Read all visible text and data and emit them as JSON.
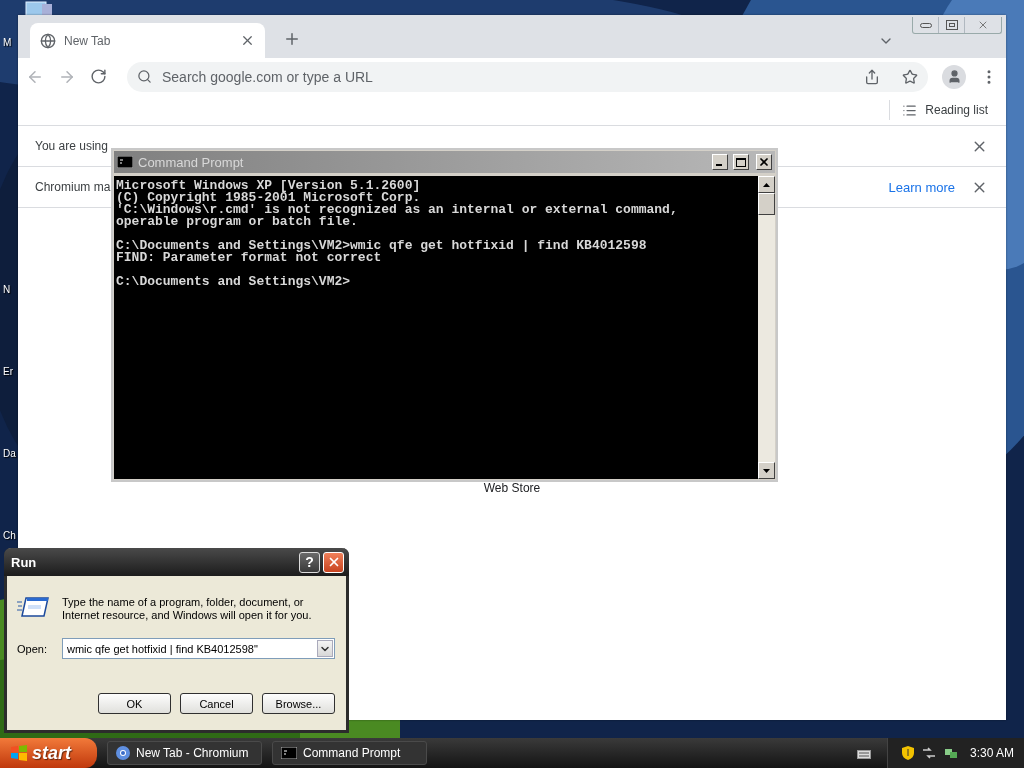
{
  "desktop": {
    "icons": [
      {
        "label": "M"
      },
      {
        "label": "N"
      },
      {
        "label": "Er"
      },
      {
        "label": "Da"
      },
      {
        "label": "Ch"
      }
    ]
  },
  "browser": {
    "tabs": [
      {
        "title": "New Tab",
        "selected": true
      }
    ],
    "omnibox": {
      "placeholder": "Search google.com or type a URL"
    },
    "bookmarks_bar": {
      "reading_list": "Reading list"
    },
    "infobars": [
      {
        "text": "You are using"
      },
      {
        "text": "Chromium ma",
        "link": "Learn more"
      }
    ],
    "content": {
      "shortcut_label": "Web Store"
    }
  },
  "console": {
    "title": "Command Prompt",
    "blocks": [
      [
        "Microsoft Windows XP [Version 5.1.2600]",
        "(C) Copyright 1985-2001 Microsoft Corp.",
        "'C:\\Windows\\r.cmd' is not recognized as an internal or external command,",
        "operable program or batch file."
      ],
      [
        "C:\\Documents and Settings\\VM2>wmic qfe get hotfixid | find KB4012598",
        "FIND: Parameter format not correct"
      ],
      [
        "C:\\Documents and Settings\\VM2>"
      ]
    ]
  },
  "run_dialog": {
    "title": "Run",
    "help_button": "?",
    "description": "Type the name of a program, folder, document, or Internet resource, and Windows will open it for you.",
    "open_label": "Open:",
    "value": "wmic qfe get hotfixid | find KB4012598\"",
    "buttons": [
      "OK",
      "Cancel",
      "Browse..."
    ]
  },
  "taskbar": {
    "start": "start",
    "items": [
      {
        "label": "New Tab - Chromium",
        "kind": "chromium"
      },
      {
        "label": "Command Prompt",
        "kind": "console"
      }
    ],
    "clock": "3:30 AM"
  }
}
